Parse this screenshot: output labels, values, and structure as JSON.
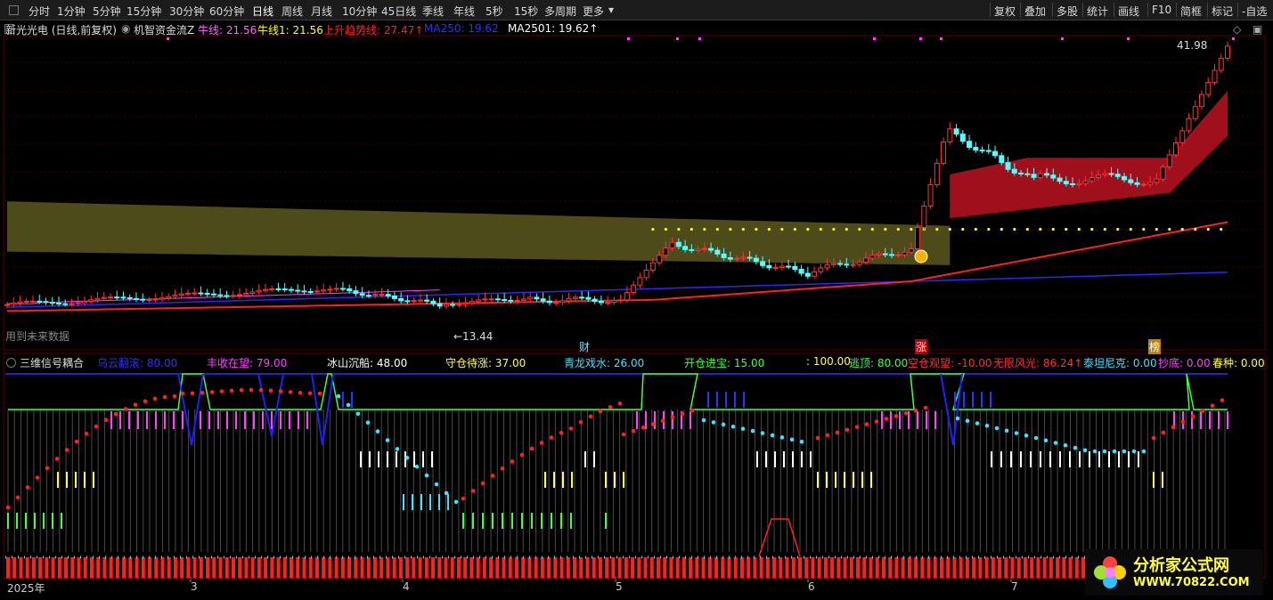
{
  "toolbar": {
    "left_items": [
      "分时",
      "1分钟",
      "5分钟",
      "15分钟",
      "30分钟",
      "60分钟",
      "日线",
      "周线",
      "月线",
      "10分钟",
      "45日线",
      "季线",
      "年线",
      "5秒",
      "15秒",
      "多周期",
      "更多"
    ],
    "active": "日线",
    "right_items": [
      "复权",
      "叠加",
      "多股",
      "统计",
      "画线",
      "F10",
      "简框",
      "标记",
      "-自选"
    ]
  },
  "main_panel": {
    "title": "新光光电 (日线,前复权)",
    "indicator": "机智资金流Z",
    "legend": [
      {
        "text": "牛线: 21.56",
        "color": "#ff66ff"
      },
      {
        "text": "牛线1: 21.56",
        "color": "#ffff00"
      },
      {
        "text": "上升趋势线: 27.47↑",
        "color": "#ff2020"
      },
      {
        "text": "MA250: 19.62",
        "color": "#3030ff"
      },
      {
        "text": "MA2501: 19.62↑",
        "color": "#ffffff"
      }
    ],
    "high_label": "41.98",
    "low_label": "←13.44",
    "future_text": "用到未来数据",
    "markers": [
      {
        "text": "财",
        "color": "#7fd7ff"
      },
      {
        "text": "涨",
        "color": "#ffffff",
        "bg": "#c00000"
      },
      {
        "text": "榜",
        "color": "#ffffff",
        "bg": "#c08000"
      }
    ]
  },
  "sub_panel": {
    "title": "三维信号耦合",
    "legend": [
      {
        "text": "乌云翻滚: 80.00",
        "color": "#3030ff"
      },
      {
        "text": "丰收在望: 79.00",
        "color": "#ff40ff"
      },
      {
        "text": "冰山沉船: 48.00",
        "color": "#ffffff"
      },
      {
        "text": "守仓待涨: 37.00",
        "color": "#ffff40"
      },
      {
        "text": "青龙戏水: 26.00",
        "color": "#40e0ff"
      },
      {
        "text": "开仓进宝: 15.00",
        "color": "#40ff40"
      },
      {
        "text": ": 100.00",
        "color": "#ffff40"
      },
      {
        "text": "逃顶: 80.00",
        "color": "#40ff40"
      },
      {
        "text": "空仓观望: -10.00",
        "color": "#ff3030"
      },
      {
        "text": "无限风光: 86.24↑",
        "color": "#ff3030"
      },
      {
        "text": "泰坦尼克: 0.00",
        "color": "#40e0ff"
      },
      {
        "text": "抄底: 0.00",
        "color": "#ff40ff"
      },
      {
        "text": "春种: 0.00",
        "color": "#ffff40"
      }
    ]
  },
  "x_axis": {
    "labels": [
      {
        "text": "2025年",
        "month": "start"
      },
      {
        "text": "3"
      },
      {
        "text": "4"
      },
      {
        "text": "5"
      },
      {
        "text": "6"
      },
      {
        "text": "7"
      }
    ]
  },
  "watermark": {
    "site": "分析家公式网",
    "url": "WWW.70822.COM"
  },
  "colors": {
    "up": "#ff3232",
    "down": "#54ffff",
    "bg": "#000000",
    "grid": "#3a0000"
  }
}
